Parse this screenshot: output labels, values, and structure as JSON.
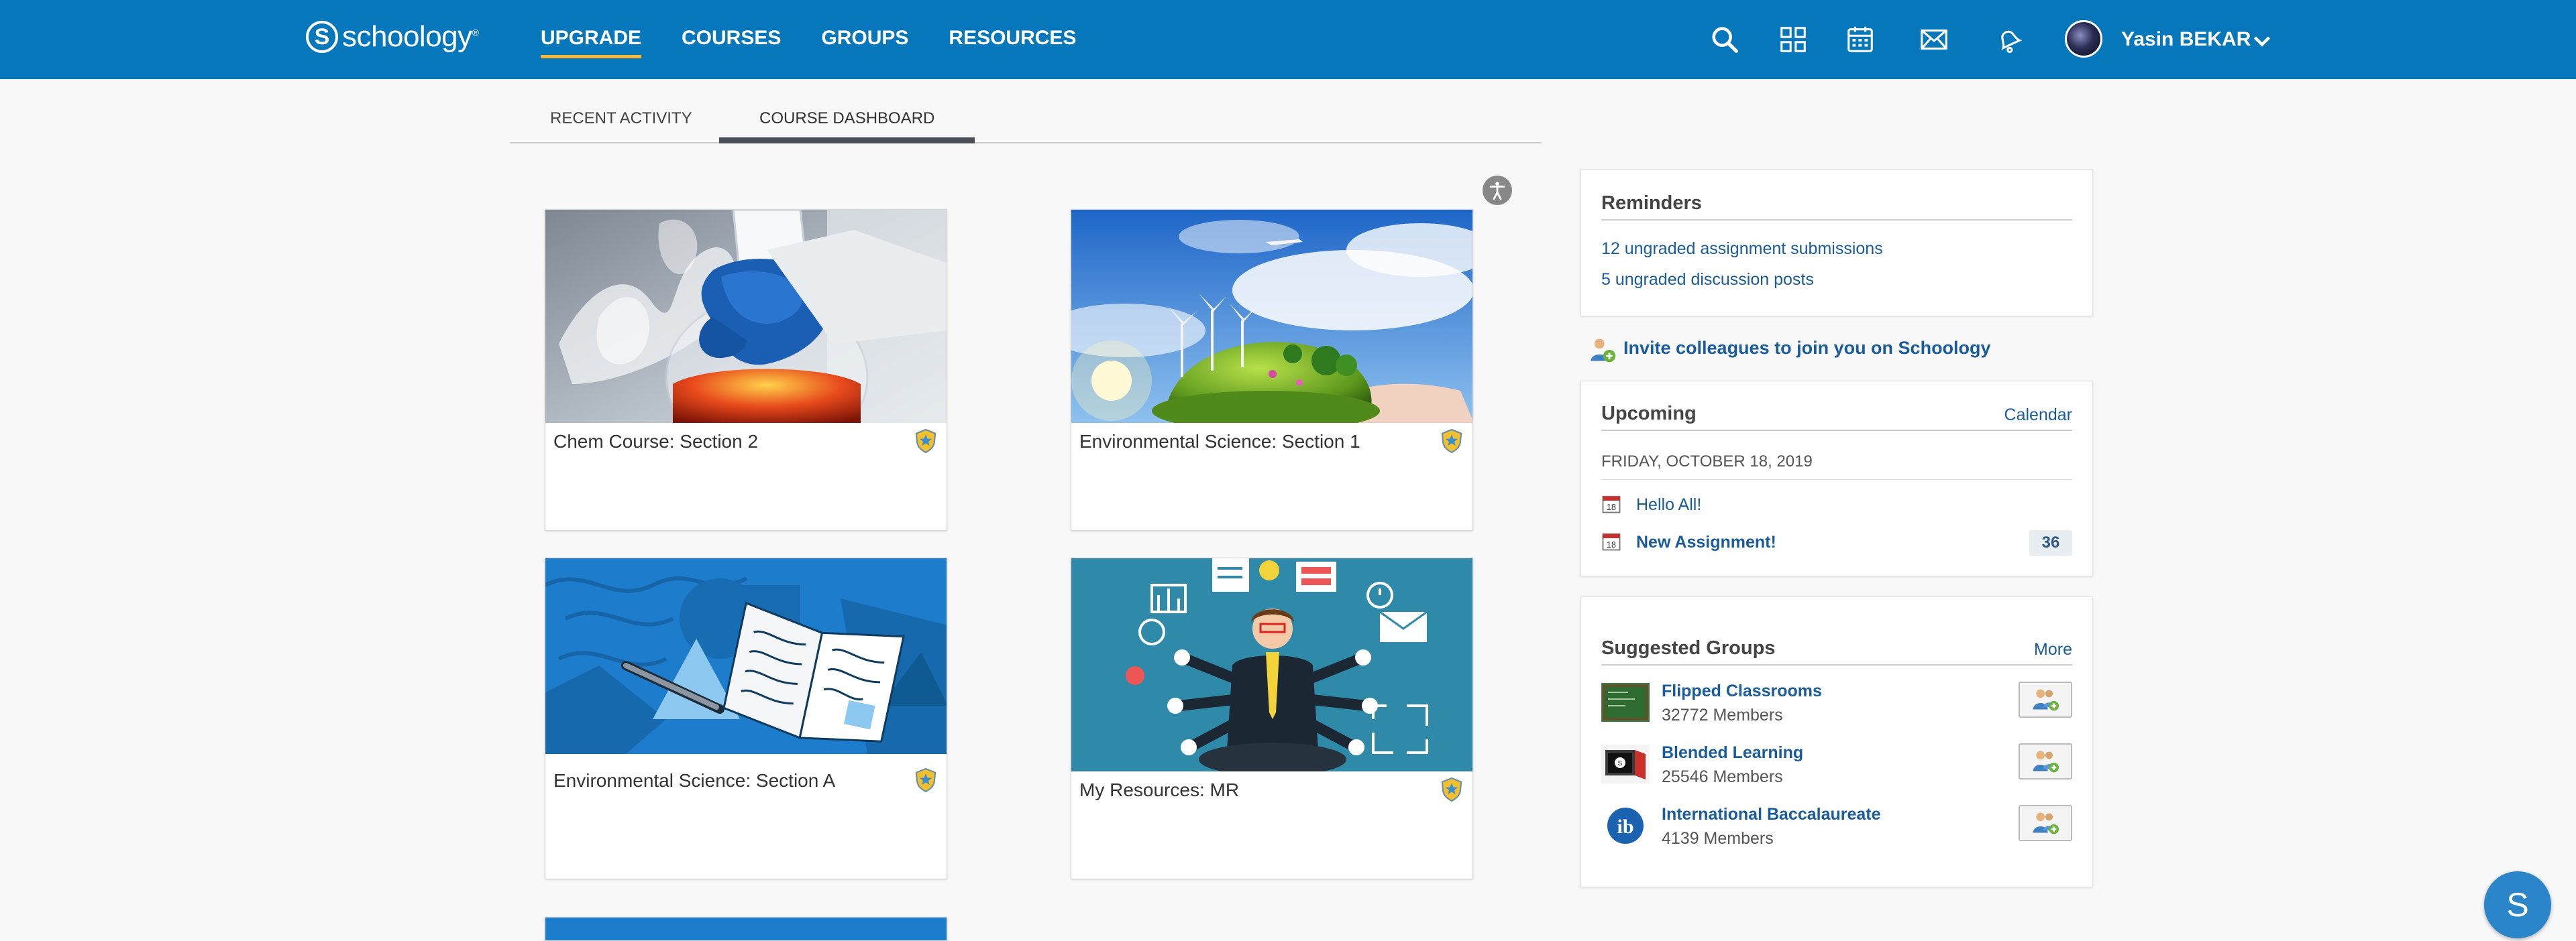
{
  "header": {
    "logo_text": "schoology",
    "logo_mark": "S",
    "logo_tm": "®",
    "nav": [
      {
        "label": "UPGRADE"
      },
      {
        "label": "COURSES"
      },
      {
        "label": "GROUPS"
      },
      {
        "label": "RESOURCES"
      }
    ],
    "icons": [
      "search-icon",
      "apps-grid-icon",
      "calendar-icon",
      "mail-icon",
      "notifications-icon"
    ],
    "user_name": "Yasin BEKAR",
    "accent_color": "#f5b63a",
    "bar_color": "#0677ba"
  },
  "tabs": [
    {
      "label": "RECENT ACTIVITY"
    },
    {
      "label": "COURSE DASHBOARD"
    }
  ],
  "accessibility_icon": "accessibility-icon",
  "courses": [
    {
      "title": "Chem Course: Section 2",
      "image": "chemistry-flask-image"
    },
    {
      "title": "Environmental Science: Section 1",
      "image": "earth-in-hand-image"
    },
    {
      "title": "Environmental Science: Section A",
      "image": "open-book-image"
    },
    {
      "title": "My Resources: MR",
      "image": "multitasking-teacher-image"
    }
  ],
  "reminders": {
    "title": "Reminders",
    "items": [
      "12 ungraded assignment submissions",
      "5 ungraded discussion posts"
    ]
  },
  "invite_text": "Invite colleagues to join you on Schoology",
  "upcoming": {
    "title": "Upcoming",
    "calendar_link": "Calendar",
    "date": "FRIDAY, OCTOBER 18, 2019",
    "calendar_day": "18",
    "events": [
      {
        "label": "Hello All!"
      },
      {
        "label": "New Assignment!",
        "count": "36"
      }
    ]
  },
  "suggested_groups": {
    "title": "Suggested Groups",
    "more_link": "More",
    "groups": [
      {
        "name": "Flipped Classrooms",
        "members": "32772 Members"
      },
      {
        "name": "Blended Learning",
        "members": "25546 Members"
      },
      {
        "name": "International Baccalaureate",
        "members": "4139 Members"
      }
    ]
  },
  "chat_button": "S"
}
